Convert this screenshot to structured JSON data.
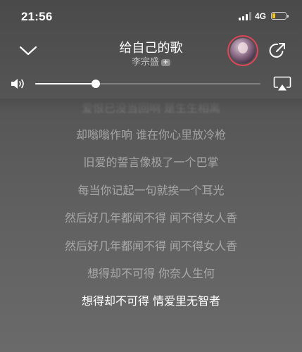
{
  "status_bar": {
    "time": "21:56",
    "network": "4G",
    "battery_level": 0.2,
    "battery_color": "#f5c518"
  },
  "header": {
    "collapse_icon": "chevron-down-icon",
    "song_title": "给自己的歌",
    "artist": "李宗盛",
    "follow_badge": "+",
    "avatar_ring_color": "#e0455a",
    "share_icon": "share-icon"
  },
  "volume": {
    "level": 0.27,
    "speaker_icon": "speaker-icon",
    "airplay_icon": "airplay-icon"
  },
  "lyrics": {
    "lines": [
      {
        "text": "爱恨已没当回响 是生生相离"
      },
      {
        "text": "却嗡嗡作响 谁在你心里放冷枪"
      },
      {
        "text": "旧爱的誓言像极了一个巴掌"
      },
      {
        "text": "每当你记起一句就挨一个耳光"
      },
      {
        "text": "然后好几年都闻不得 闻不得女人香"
      },
      {
        "text": "然后好几年都闻不得 闻不得女人香"
      },
      {
        "text": "想得却不可得 你奈人生何"
      },
      {
        "text": "想得却不可得 情爱里无智者"
      }
    ],
    "current_index": 7
  }
}
